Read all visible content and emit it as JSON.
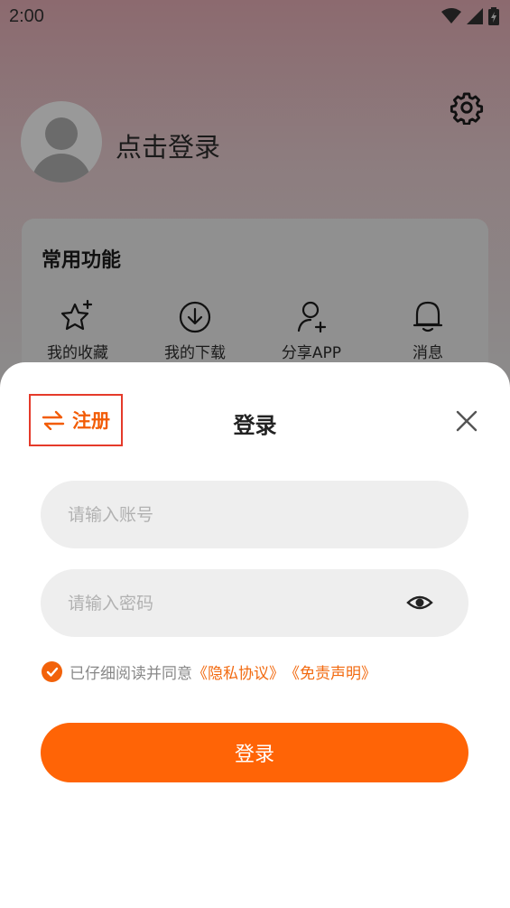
{
  "status": {
    "time": "2:00"
  },
  "profile": {
    "login_prompt": "点击登录"
  },
  "features": {
    "title": "常用功能",
    "items": [
      {
        "label": "我的收藏",
        "icon": "star-icon"
      },
      {
        "label": "我的下载",
        "icon": "download-icon"
      },
      {
        "label": "分享APP",
        "icon": "share-user-icon"
      },
      {
        "label": "消息",
        "icon": "bell-icon"
      }
    ]
  },
  "login_sheet": {
    "register_label": "注册",
    "title": "登录",
    "account_placeholder": "请输入账号",
    "password_placeholder": "请输入密码",
    "agree_text": "已仔细阅读并同意",
    "privacy_link": "《隐私协议》",
    "disclaimer_link": "《免责声明》",
    "login_button": "登录"
  },
  "colors": {
    "accent": "#ff6406",
    "register_border": "#e53a2a"
  }
}
